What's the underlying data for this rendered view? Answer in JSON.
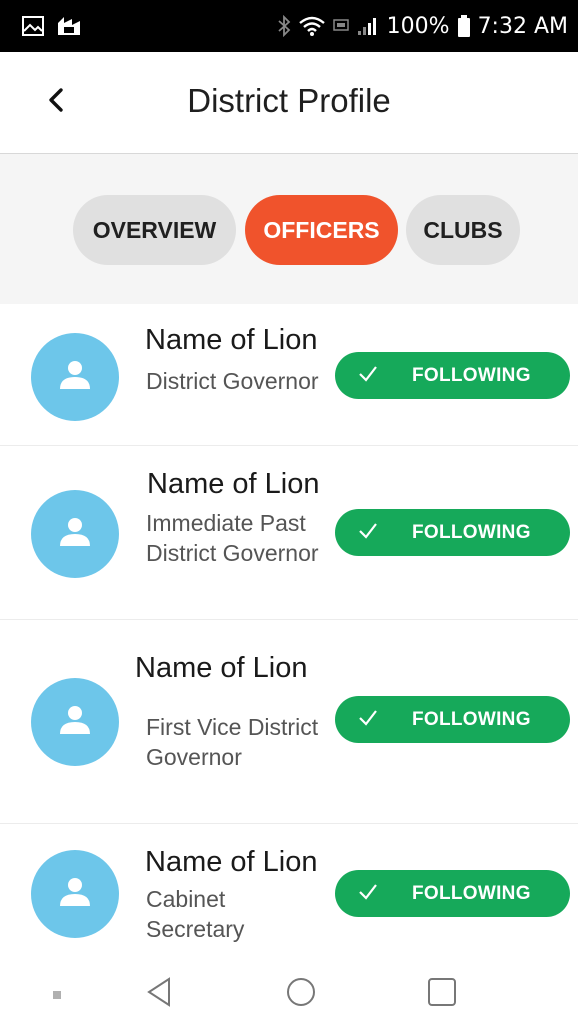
{
  "status_bar": {
    "battery": "100%",
    "time": "7:32 AM",
    "icons": [
      "image-icon",
      "app-notification-icon",
      "bluetooth-icon",
      "wifi-icon",
      "lte-icon",
      "signal-icon",
      "battery-icon"
    ]
  },
  "header": {
    "title": "District Profile",
    "back_icon": "chevron-left-icon"
  },
  "tabs": [
    {
      "label": "OVERVIEW",
      "active": false
    },
    {
      "label": "OFFICERS",
      "active": true
    },
    {
      "label": "CLUBS",
      "active": false
    }
  ],
  "officers": [
    {
      "name": "Name of Lion",
      "title": "District Governor",
      "follow_label": "FOLLOWING"
    },
    {
      "name": "Name of Lion",
      "title": "Immediate Past District Governor",
      "follow_label": "FOLLOWING"
    },
    {
      "name": "Name of Lion",
      "title": "First Vice District Governor",
      "follow_label": "FOLLOWING"
    },
    {
      "name": "Name of Lion",
      "title": "Cabinet Secretary",
      "follow_label": "FOLLOWING"
    }
  ],
  "nav_bar": {
    "icons": [
      "recent-dot-icon",
      "back-triangle-icon",
      "home-circle-icon",
      "overview-square-icon"
    ]
  },
  "colors": {
    "accent": "#f0532c",
    "following": "#16a95a",
    "avatar": "#6dc6ea",
    "tab_inactive": "#e0e0e0"
  }
}
